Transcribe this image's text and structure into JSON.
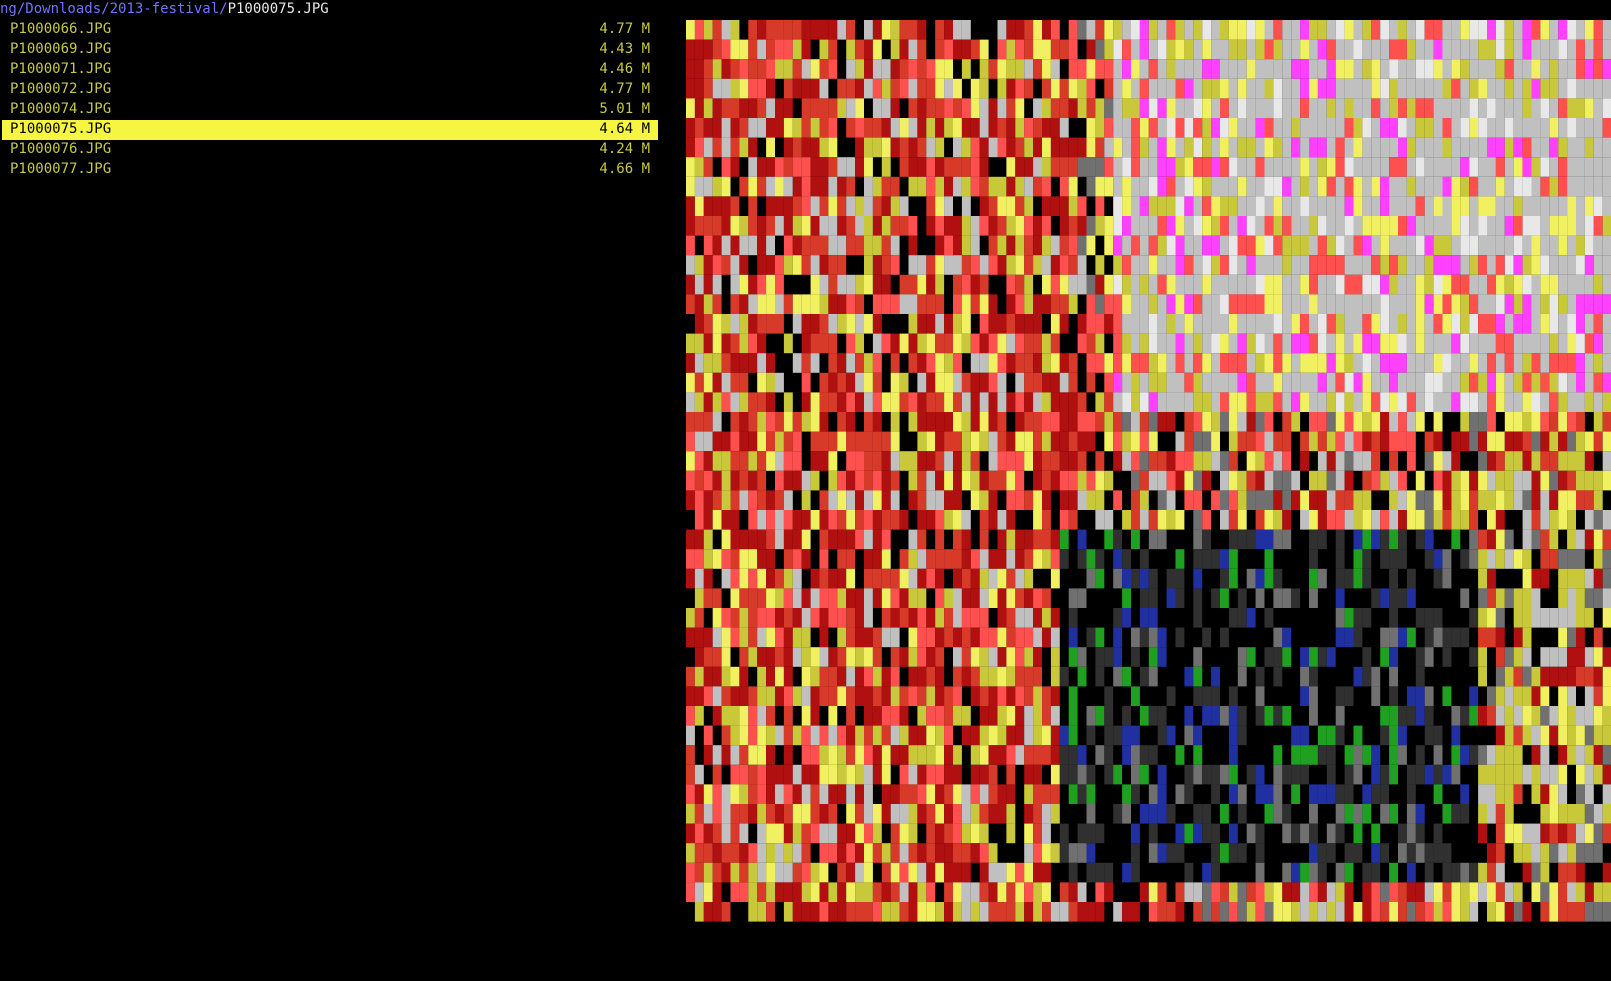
{
  "path": {
    "dir": "ng/Downloads/2013-festival/",
    "file": "P1000075.JPG"
  },
  "files": [
    {
      "name": "P1000066.JPG",
      "size": "4.77 M",
      "selected": false
    },
    {
      "name": "P1000069.JPG",
      "size": "4.43 M",
      "selected": false
    },
    {
      "name": "P1000071.JPG",
      "size": "4.46 M",
      "selected": false
    },
    {
      "name": "P1000072.JPG",
      "size": "4.77 M",
      "selected": false
    },
    {
      "name": "P1000074.JPG",
      "size": "5.01 M",
      "selected": false
    },
    {
      "name": "P1000075.JPG",
      "size": "4.64 M",
      "selected": true
    },
    {
      "name": "P1000076.JPG",
      "size": "4.24 M",
      "selected": false
    },
    {
      "name": "P1000077.JPG",
      "size": "4.66 M",
      "selected": false
    }
  ],
  "preview": {
    "palette": [
      "#000000",
      "#b01010",
      "#d83a2a",
      "#ff5050",
      "#c8c83a",
      "#f0f060",
      "#c0c0c0",
      "#e8e8e8",
      "#707070",
      "#303030",
      "#ff40ff",
      "#20a020",
      "#2030a0"
    ]
  },
  "colors": {
    "background": "#000000",
    "text": "#c8c84a",
    "selection": "#f5f542",
    "path_dir": "#6f74ff"
  }
}
